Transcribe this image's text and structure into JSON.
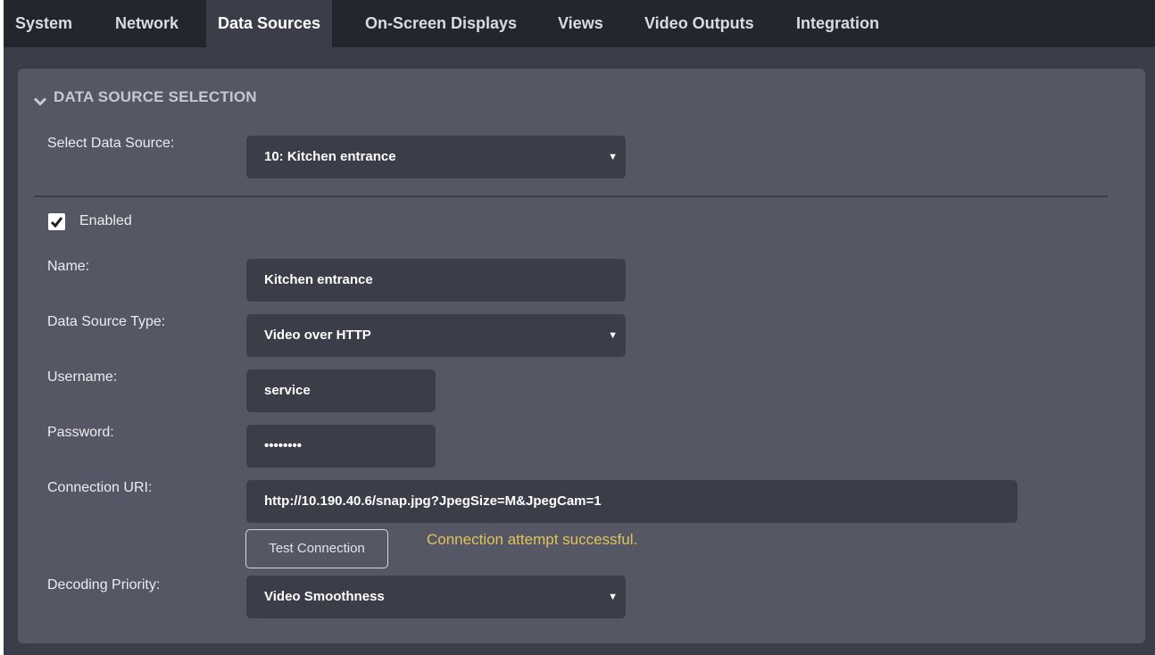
{
  "tabs": [
    {
      "label": "System"
    },
    {
      "label": "Network"
    },
    {
      "label": "Data Sources"
    },
    {
      "label": "On-Screen Displays"
    },
    {
      "label": "Views"
    },
    {
      "label": "Video Outputs"
    },
    {
      "label": "Integration"
    }
  ],
  "active_tab": "Data Sources",
  "section": {
    "title": "DATA SOURCE SELECTION",
    "icon": "chevron-down-icon"
  },
  "form": {
    "select_source": {
      "label": "Select Data Source:",
      "value": "10: Kitchen entrance"
    },
    "enabled": {
      "label": "Enabled",
      "checked": true
    },
    "name": {
      "label": "Name:",
      "value": "Kitchen entrance"
    },
    "source_type": {
      "label": "Data Source Type:",
      "value": "Video over HTTP"
    },
    "username": {
      "label": "Username:",
      "value": "service"
    },
    "password": {
      "label": "Password:",
      "value": "••••••••"
    },
    "connection_uri": {
      "label": "Connection URI:",
      "value": "http://10.190.40.6/snap.jpg?JpegSize=M&JpegCam=1"
    },
    "test_button": "Test Connection",
    "status": "Connection attempt successful.",
    "decoding_priority": {
      "label": "Decoding Priority:",
      "value": "Video Smoothness"
    }
  },
  "colors": {
    "background": "#3b3d48",
    "tabbar": "#24262e",
    "panel": "#555864",
    "field": "#3b3d48",
    "status_text": "#e1c25b"
  }
}
